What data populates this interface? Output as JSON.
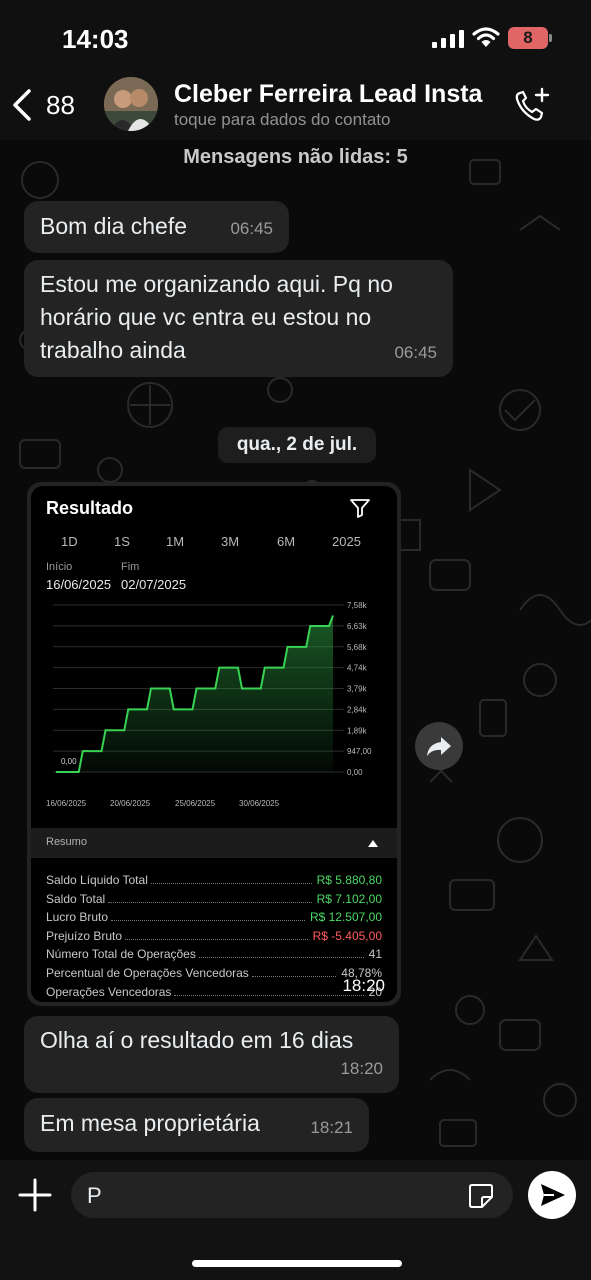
{
  "status": {
    "time": "14:03",
    "battery": "8"
  },
  "header": {
    "back_count": "88",
    "contact_name": "Cleber Ferreira Lead Insta",
    "contact_subtitle": "toque para dados do contato"
  },
  "chat": {
    "unread_label": "Mensagens não lidas: 5",
    "date_divider": "qua., 2 de jul.",
    "messages": [
      {
        "text": "Bom dia chefe",
        "time": "06:45"
      },
      {
        "text": "Estou me organizando aqui. Pq no horário que vc entra eu estou no trabalho ainda",
        "time": "06:45"
      },
      {
        "text": "Olha aí o resultado em 16 dias",
        "time": "18:20"
      },
      {
        "text": "Em mesa proprietária",
        "time": "18:21"
      }
    ],
    "image_time": "18:20"
  },
  "screenshot": {
    "title": "Resultado",
    "periods": [
      "1D",
      "1S",
      "1M",
      "3M",
      "6M",
      "2025"
    ],
    "start_label": "Início",
    "start_value": "16/06/2025",
    "end_label": "Fim",
    "end_value": "02/07/2025",
    "resumo_label": "Resumo",
    "summary": [
      {
        "label": "Saldo Líquido Total",
        "value": "R$ 5.880,80",
        "tone": "green"
      },
      {
        "label": "Saldo Total",
        "value": "R$ 7.102,00",
        "tone": "green"
      },
      {
        "label": "Lucro Bruto",
        "value": "R$ 12.507,00",
        "tone": "green"
      },
      {
        "label": "Prejuízo Bruto",
        "value": "R$ -5.405,00",
        "tone": "red"
      },
      {
        "label": "Número Total de Operações",
        "value": "41",
        "tone": "plain"
      },
      {
        "label": "Percentual de Operações Vencedoras",
        "value": "48,78%",
        "tone": "plain"
      },
      {
        "label": "Operações Vencedoras",
        "value": "20",
        "tone": "plain"
      }
    ]
  },
  "chart_data": {
    "type": "area",
    "x_tick_labels": [
      "16/06/2025",
      "20/06/2025",
      "25/06/2025",
      "30/06/2025"
    ],
    "y_tick_labels": [
      "7,58k",
      "6,63k",
      "5,68k",
      "4,74k",
      "3,79k",
      "2,84k",
      "1,89k",
      "947,00",
      "0,00"
    ],
    "ylim": [
      0,
      7580
    ],
    "start_annotation": "0,00",
    "step_values": [
      0,
      947,
      1894,
      2841,
      3788,
      2841,
      3788,
      4735,
      3788,
      4735,
      5682,
      6629,
      7102
    ],
    "color": "#39d353"
  },
  "composer": {
    "input_value": "P"
  }
}
